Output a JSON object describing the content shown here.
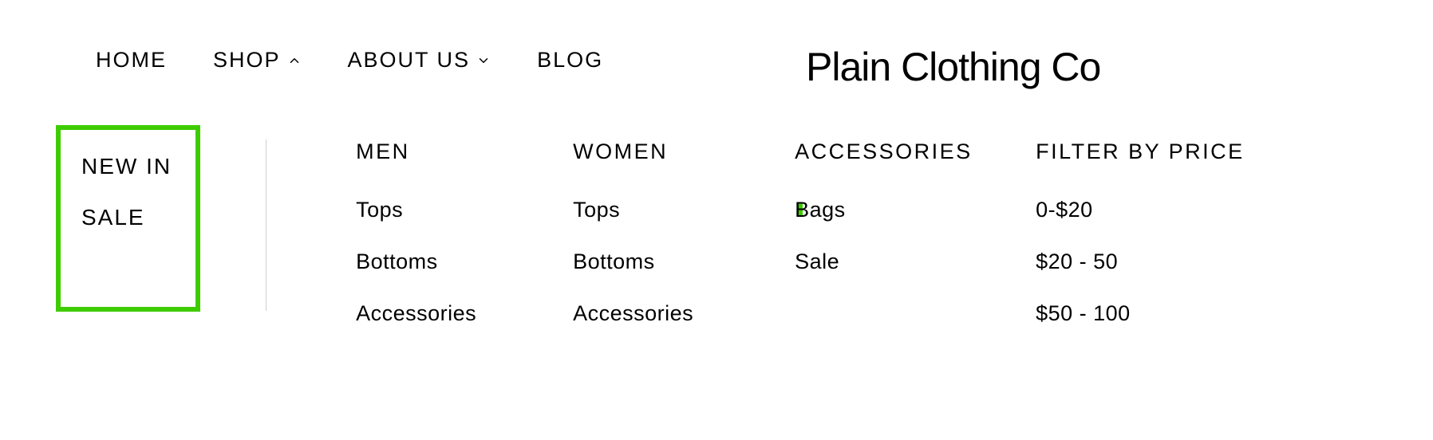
{
  "brand": "Plain Clothing Co",
  "nav": {
    "home": "HOME",
    "shop": "SHOP",
    "about": "ABOUT US",
    "blog": "BLOG"
  },
  "sidebar": {
    "newin": "NEW IN",
    "sale": "SALE"
  },
  "columns": {
    "men": {
      "heading": "MEN",
      "items": [
        "Tops",
        "Bottoms",
        "Accessories"
      ]
    },
    "women": {
      "heading": "WOMEN",
      "items": [
        "Tops",
        "Bottoms",
        "Accessories"
      ]
    },
    "accessories": {
      "heading": "ACCESSORIES",
      "items": [
        "Bags",
        "Sale"
      ]
    },
    "filter": {
      "heading": "FILTER BY PRICE",
      "items": [
        "0-$20",
        "$20 - 50",
        "$50 - 100"
      ]
    }
  }
}
